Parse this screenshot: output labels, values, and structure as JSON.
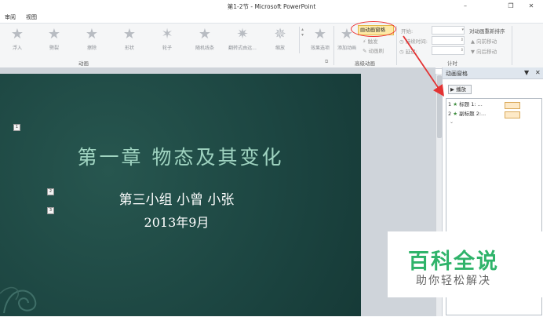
{
  "window": {
    "title": "第1-2节 - Microsoft PowerPoint",
    "min": "–",
    "max": "❐",
    "close": "✕"
  },
  "tabs": [
    "审阅",
    "视图"
  ],
  "ribbon": {
    "effects": [
      {
        "label": "浮入",
        "icon": "float-in-star-icon"
      },
      {
        "label": "劈裂",
        "icon": "split-star-icon"
      },
      {
        "label": "擦除",
        "icon": "wipe-star-icon"
      },
      {
        "label": "形状",
        "icon": "shape-star-icon"
      },
      {
        "label": "轮子",
        "icon": "wheel-star-icon"
      },
      {
        "label": "随机线条",
        "icon": "random-bars-star-icon"
      },
      {
        "label": "翻转式由远...",
        "icon": "grow-turn-star-icon"
      },
      {
        "label": "缩放",
        "icon": "zoom-star-icon"
      }
    ],
    "effect_options": "效果选项",
    "add_animation": "添加动画",
    "animation_pane": "动画窗格",
    "trigger": "触发",
    "animation_painter": "动画刷",
    "start_label": "开始:",
    "duration_label": "持续时间:",
    "delay_label": "延迟:",
    "reorder_title": "对动画重新排序",
    "move_earlier": "向前移动",
    "move_later": "向后移动",
    "group_animation": "动画",
    "group_advanced": "高级动画",
    "group_timing": "计时",
    "highlight_color": "#e33333"
  },
  "slide": {
    "markers": [
      "1",
      "2",
      "3"
    ],
    "title": "第一章  物态及其变化",
    "subtitle1": "第三小组 小曾 小张",
    "subtitle2": "2013年9月",
    "bg_color": "#1f4a46",
    "title_color": "#9fd3c0"
  },
  "pane": {
    "title": "动画窗格",
    "play": "播放",
    "rows": [
      {
        "num": "1",
        "text": "标题 1: ..."
      },
      {
        "num": "2",
        "text": "副标题 2:..."
      }
    ]
  },
  "watermark": {
    "main": "百科全说",
    "sub": "助你轻松解决",
    "color": "#2fb36a"
  }
}
